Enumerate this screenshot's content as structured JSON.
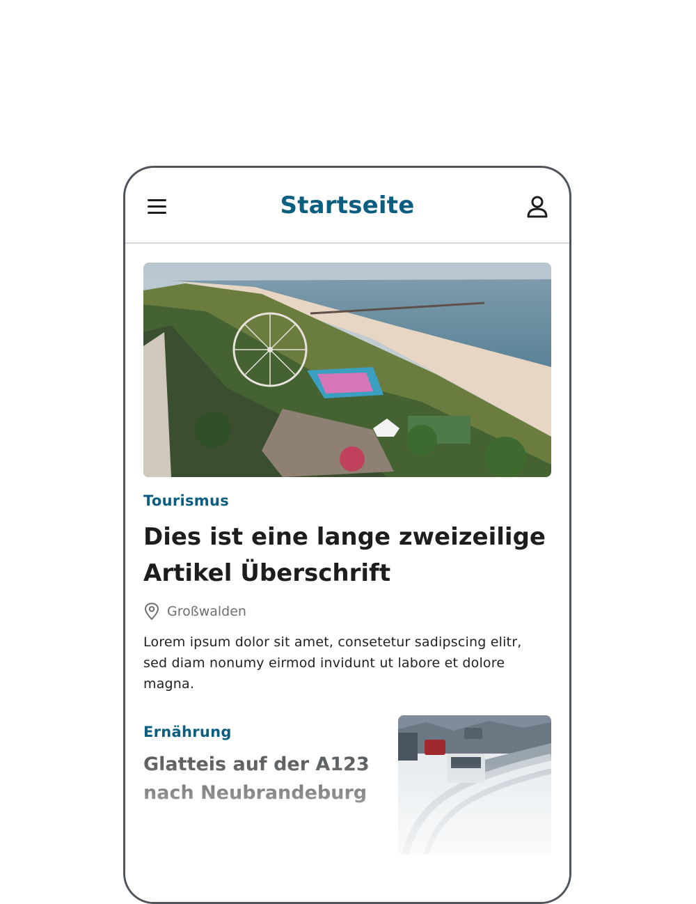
{
  "header": {
    "title": "Startseite",
    "menu_icon": "hamburger-menu-icon",
    "profile_icon": "user-icon"
  },
  "featured": {
    "image": "aerial-beach-fairground-photo",
    "category": "Tourismus",
    "headline": "Dies ist eine lange zweizeilige Artikel Überschrift",
    "location_icon": "map-pin-icon",
    "location": "Großwalden",
    "teaser": "Lorem ipsum dolor sit amet, consetetur sadipscing elitr, sed diam nonumy eirmod  invidunt ut labore et dolore magna."
  },
  "second": {
    "category": "Ernährung",
    "headline_line1": "Glatteis auf der A123",
    "headline_line2": "nach Neubrandeburg",
    "image": "snowy-highway-photo"
  },
  "colors": {
    "accent": "#0b5e80",
    "text": "#1b1d1f",
    "muted": "#6a6f73",
    "frame": "#4f555a"
  }
}
